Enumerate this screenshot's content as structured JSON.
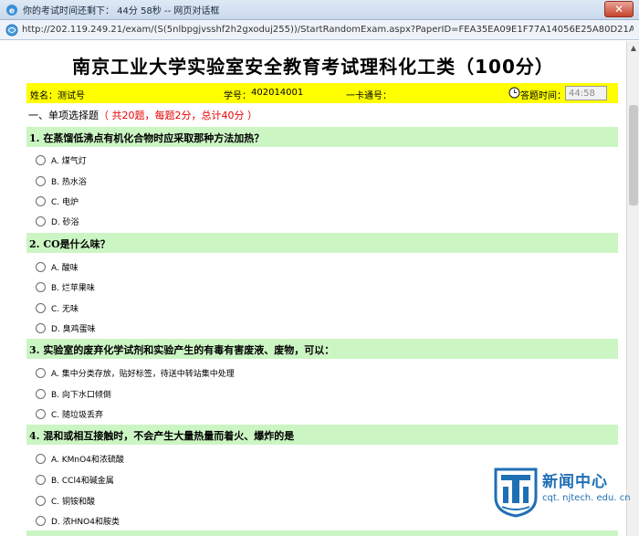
{
  "window": {
    "title": "你的考试时间还剩下： 44分 58秒 -- 网页对话框",
    "close_label": "✕"
  },
  "address": {
    "url": "http://202.119.249.21/exam/(S(5nlbpgjvsshf2h2gxoduj255))/StartRandomExam.aspx?PaperID=FEA35EA09E1F77A14056E25A80D21A3A"
  },
  "page": {
    "title": "南京工业大学实验室安全教育考试理科化工类（100分）"
  },
  "infobar": {
    "name_label": "姓名：",
    "name_value": "测试号",
    "student_id_label": "学号：",
    "student_id_value": "402014001",
    "card_label": "一卡通号：",
    "card_value": "",
    "time_label": "答题时间：",
    "time_value": "44:58"
  },
  "section": {
    "title": "一、单项选择题",
    "info": "（ 共20题，每题2分，总计40分 ）"
  },
  "questions": [
    {
      "text": "1. 在蒸馏低沸点有机化合物时应采取那种方法加热？",
      "options": [
        "A. 煤气灯",
        "B. 热水浴",
        "C. 电炉",
        "D. 砂浴"
      ]
    },
    {
      "text": "2. CO是什么味？",
      "options": [
        "A. 酸味",
        "B. 烂苹果味",
        "C. 无味",
        "D. 臭鸡蛋味"
      ]
    },
    {
      "text": "3. 实验室的废弃化学试剂和实验产生的有毒有害废液、废物，可以：",
      "options": [
        "A. 集中分类存放，贴好标签，待送中转站集中处理",
        "B. 向下水口倾倒",
        "C. 随垃圾丢弃"
      ]
    },
    {
      "text": "4. 混和或相互接触时，不会产生大量热量而着火、爆炸的是",
      "options": [
        "A. KMnO4和浓硫酸",
        "B. CCl4和碱金属",
        "C. 铜铵和酸",
        "D. 浓HNO4和胺类"
      ]
    }
  ],
  "watermark": {
    "title": "新闻中心",
    "url": "cqt. njtech. edu. cn"
  }
}
